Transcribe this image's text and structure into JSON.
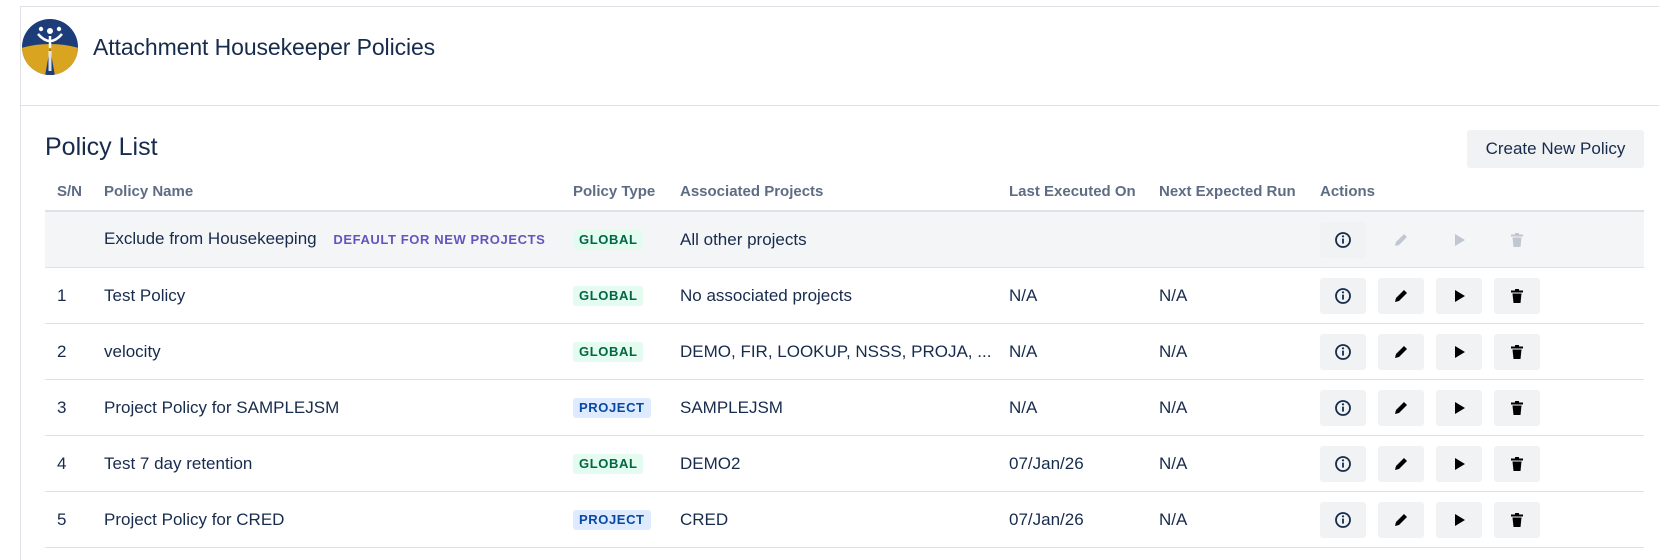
{
  "app": {
    "title": "Attachment Housekeeper Policies"
  },
  "section": {
    "title": "Policy List",
    "create_button": "Create New Policy"
  },
  "table": {
    "columns": [
      "S/N",
      "Policy Name",
      "Policy Type",
      "Associated Projects",
      "Last Executed On",
      "Next Expected Run",
      "Actions"
    ],
    "default_row": {
      "sn": "",
      "name": "Exclude from Housekeeping",
      "badge": "DEFAULT FOR NEW PROJECTS",
      "type": "GLOBAL",
      "projects": "All other projects",
      "last_executed": "",
      "next_run": ""
    },
    "rows": [
      {
        "sn": "1",
        "name": "Test Policy",
        "type": "GLOBAL",
        "projects": "No associated projects",
        "last_executed": "N/A",
        "next_run": "N/A"
      },
      {
        "sn": "2",
        "name": "velocity",
        "type": "GLOBAL",
        "projects": "DEMO, FIR, LOOKUP, NSSS, PROJA, ...",
        "last_executed": "N/A",
        "next_run": "N/A"
      },
      {
        "sn": "3",
        "name": "Project Policy for SAMPLEJSM",
        "type": "PROJECT",
        "projects": "SAMPLEJSM",
        "last_executed": "N/A",
        "next_run": "N/A"
      },
      {
        "sn": "4",
        "name": "Test 7 day retention",
        "type": "GLOBAL",
        "projects": "DEMO2",
        "last_executed": "07/Jan/26",
        "next_run": "N/A"
      },
      {
        "sn": "5",
        "name": "Project Policy for CRED",
        "type": "PROJECT",
        "projects": "CRED",
        "last_executed": "07/Jan/26",
        "next_run": "N/A"
      }
    ]
  },
  "icons": {
    "info": "info-icon",
    "edit": "pencil-icon",
    "run": "play-icon",
    "delete": "trash-icon"
  },
  "colors": {
    "global_bg": "#e3fcef",
    "global_text": "#006644",
    "project_bg": "#deebff",
    "project_text": "#0747a6",
    "default_badge": "#6554c0",
    "logo_navy": "#1d3c7a",
    "logo_gold": "#d9a521"
  }
}
